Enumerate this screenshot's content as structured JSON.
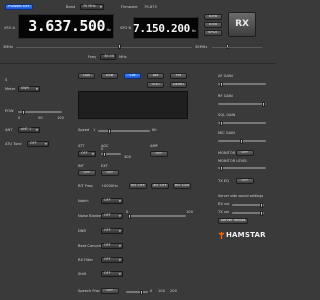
{
  "header": {
    "power_label": "POWER OFF",
    "band_label": "Band",
    "band_value": "70 MHz",
    "for_label": "Firmware",
    "fw_value": "79-875"
  },
  "vfo_a": {
    "label": "VFO A",
    "freq": "3.637.500",
    "unit": "Hz"
  },
  "vfo_b": {
    "label": "VFO B",
    "freq": "7.150.200",
    "unit": "Hz"
  },
  "vfo_buttons": {
    "a_to_b": "A>B",
    "b_to_a": "A<B",
    "split": "SPLIT"
  },
  "rx_label": "RX",
  "scale": {
    "left": "3MHz",
    "right": "30MHz",
    "freq_label": "Freq",
    "freq_value": "30.00",
    "freq_unit": "MHz"
  },
  "left": {
    "s_label": "S",
    "meter_label": "Meter",
    "meter_value": "SWR",
    "pow_label": "POW",
    "pow_ticks": [
      "0",
      "50",
      "100"
    ],
    "ant_label": "ANT",
    "ant_value": "ANT 1",
    "atu_label": "ATU Tune",
    "atu_value": "OFF"
  },
  "modes": [
    "LSB",
    "USB",
    "CW",
    "AM",
    "FM"
  ],
  "mode_row2": [
    "TEXT",
    "DEMO"
  ],
  "speed": {
    "label": "Speed",
    "min": "1",
    "max": "60"
  },
  "att": {
    "att_label": "ATT",
    "agc_label": "AGC",
    "amp_label": "AMP",
    "att_value": "OFF",
    "agc_value": "OFF",
    "amp_value": "OFF",
    "tick0": "0",
    "tick1": "300"
  },
  "int": {
    "int_label": "INT",
    "ext_label": "EXT",
    "int_value": "OFF",
    "ext_value": "OFF"
  },
  "rit": {
    "label": "RIT Freq",
    "value": "+0000Hz",
    "rit_btn": "RIT OFF",
    "xit_btn": "XIT OFF",
    "clr_btn": "RIT CLR"
  },
  "rows": [
    {
      "label": "Notch",
      "value": "OFF"
    },
    {
      "label": "Noise Blanker",
      "value": "OFF"
    },
    {
      "label": "DNR",
      "value": "OFF"
    },
    {
      "label": "Beat Canceler",
      "value": "OFF"
    },
    {
      "label": "RX Filter",
      "value": "OFF"
    },
    {
      "label": "Shift",
      "value": "OFF"
    },
    {
      "label": "Speech Proc",
      "value": "OFF"
    }
  ],
  "nb_range": {
    "min": "0",
    "max": "100"
  },
  "proc_ticks": [
    "0",
    "100",
    "200"
  ],
  "right": {
    "af_gain": "AF GAIN",
    "rf_gain": "RF GAIN",
    "sql_gain": "SQL GAIN",
    "mic_gain": "MIC GAIN",
    "monitor": "MONITOR",
    "monitor_value": "OFF",
    "monitor_level": "MONITOR LEVEL",
    "tx_eq": "TX EQ",
    "tx_eq_value": "OFF",
    "server_label": "Server side sound settings",
    "rx_vol": "RX vol",
    "tx_vol": "TX vol",
    "server_btn": "Server reboot"
  },
  "logo": "HAMSTAR",
  "colors": {
    "accent": "#2a64ff",
    "bg": "#3a3a3a",
    "display_bg": "#050505"
  }
}
